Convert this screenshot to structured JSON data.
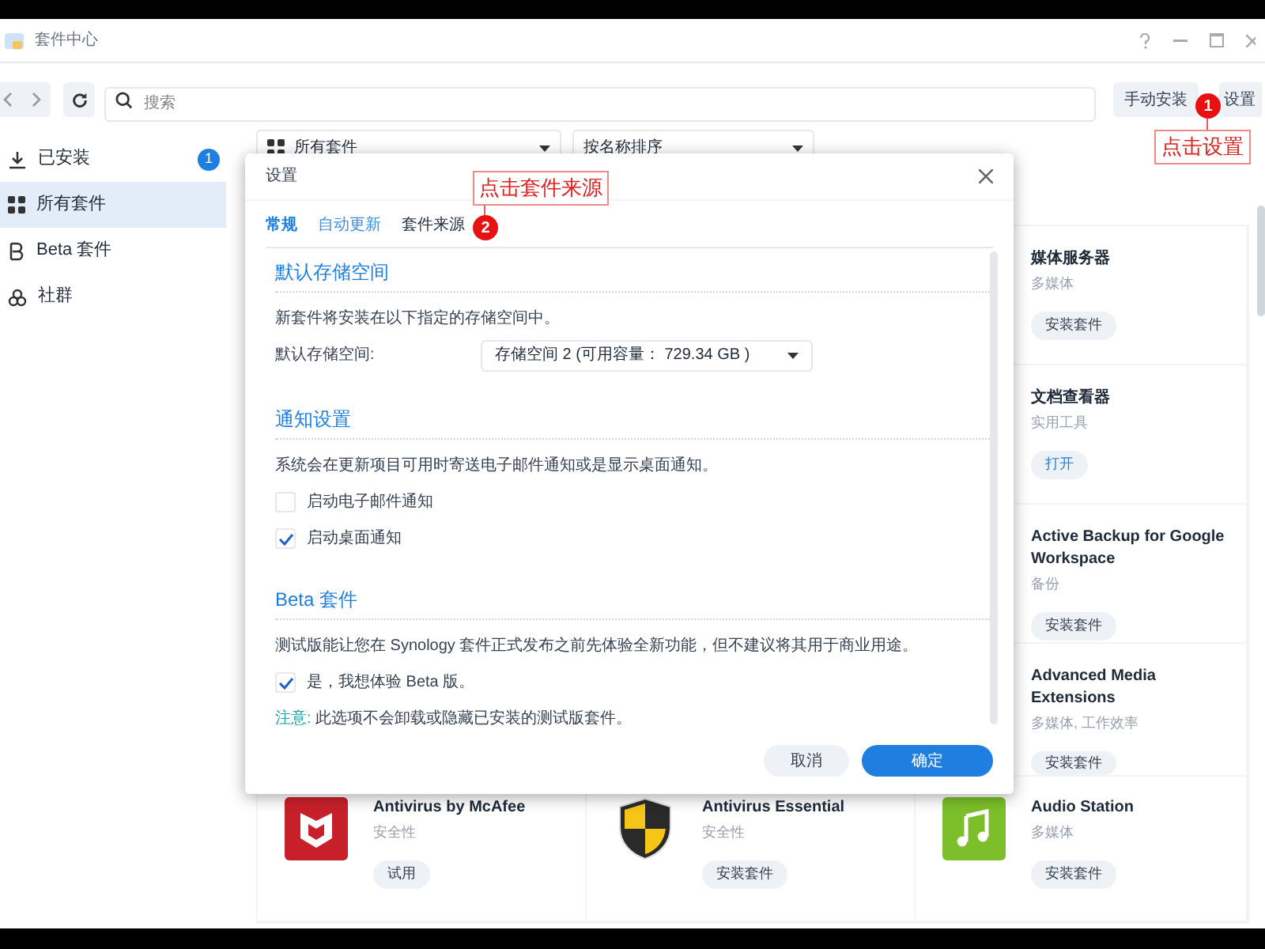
{
  "window": {
    "title": "套件中心"
  },
  "toolbar": {
    "search": {
      "placeholder": "搜索"
    },
    "buttons": [
      "手动安装",
      "设置"
    ]
  },
  "sidebar": {
    "items": [
      {
        "label": "已安装",
        "kind": "installed",
        "badge": "1",
        "selected": false
      },
      {
        "label": "所有套件",
        "kind": "all",
        "selected": true
      },
      {
        "label": "Beta 套件",
        "kind": "beta",
        "selected": false
      },
      {
        "label": "社群",
        "kind": "community",
        "selected": false
      }
    ]
  },
  "filters": [
    {
      "label": "所有套件",
      "kind": "grid"
    },
    {
      "label": "按名称排序",
      "kind": "plain"
    }
  ],
  "right_column": [
    {
      "name": "媒体服务器",
      "category": "多媒体",
      "button": {
        "label": "安装套件",
        "kind": "install"
      }
    },
    {
      "name": "文档查看器",
      "category": "实用工具",
      "button": {
        "label": "打开",
        "kind": "open"
      }
    },
    {
      "name": "Active Backup for Google Workspace",
      "category": "备份",
      "button": {
        "label": "安装套件",
        "kind": "install"
      }
    },
    {
      "name": "Advanced Media Extensions",
      "category": "多媒体, 工作效率",
      "button": {
        "label": "安装套件",
        "kind": "install"
      }
    }
  ],
  "bottom_row": [
    {
      "name": "Antivirus by McAfee",
      "category": "安全性",
      "button": {
        "label": "试用",
        "kind": "install"
      }
    },
    {
      "name": "Antivirus Essential",
      "category": "安全性",
      "button": {
        "label": "安装套件",
        "kind": "install"
      }
    },
    {
      "name": "Audio Station",
      "category": "多媒体",
      "button": {
        "label": "安装套件",
        "kind": "install"
      }
    }
  ],
  "annotations": [
    {
      "number": "1",
      "label": "点击设置"
    },
    {
      "number": "2",
      "label": "点击套件来源"
    }
  ],
  "dialog": {
    "title": "设置",
    "tabs": [
      {
        "label": "常规",
        "selected": true,
        "hovered": false
      },
      {
        "label": "自动更新",
        "selected": false,
        "hovered": true
      },
      {
        "label": "套件来源",
        "selected": false,
        "hovered": false
      }
    ],
    "sections": [
      {
        "title": "默认存储空间",
        "items": [
          {
            "kind": "text",
            "text": "新套件将安装在以下指定的存储空间中。"
          },
          {
            "kind": "select",
            "label": "默认存储空间:",
            "value": "存储空间 2 (可用容量： 729.34 GB )"
          }
        ]
      },
      {
        "title": "通知设置",
        "items": [
          {
            "kind": "text",
            "text": "系统会在更新项目可用时寄送电子邮件通知或是显示桌面通知。"
          },
          {
            "kind": "checkbox",
            "label": "启动电子邮件通知",
            "checked": false
          },
          {
            "kind": "checkbox",
            "label": "启动桌面通知",
            "checked": true
          }
        ]
      },
      {
        "title": "Beta 套件",
        "items": [
          {
            "kind": "text",
            "text": "测试版能让您在 Synology 套件正式发布之前先体验全新功能，但不建议将其用于商业用途。"
          },
          {
            "kind": "checkbox",
            "label": "是，我想体验 Beta 版。",
            "checked": true
          },
          {
            "kind": "note",
            "label": "注意:",
            "text": " 此选项不会卸载或隐藏已安装的测试版套件。"
          }
        ]
      }
    ],
    "buttons": [
      {
        "label": "取消",
        "kind": "secondary"
      },
      {
        "label": "确定",
        "kind": "primary"
      }
    ]
  }
}
